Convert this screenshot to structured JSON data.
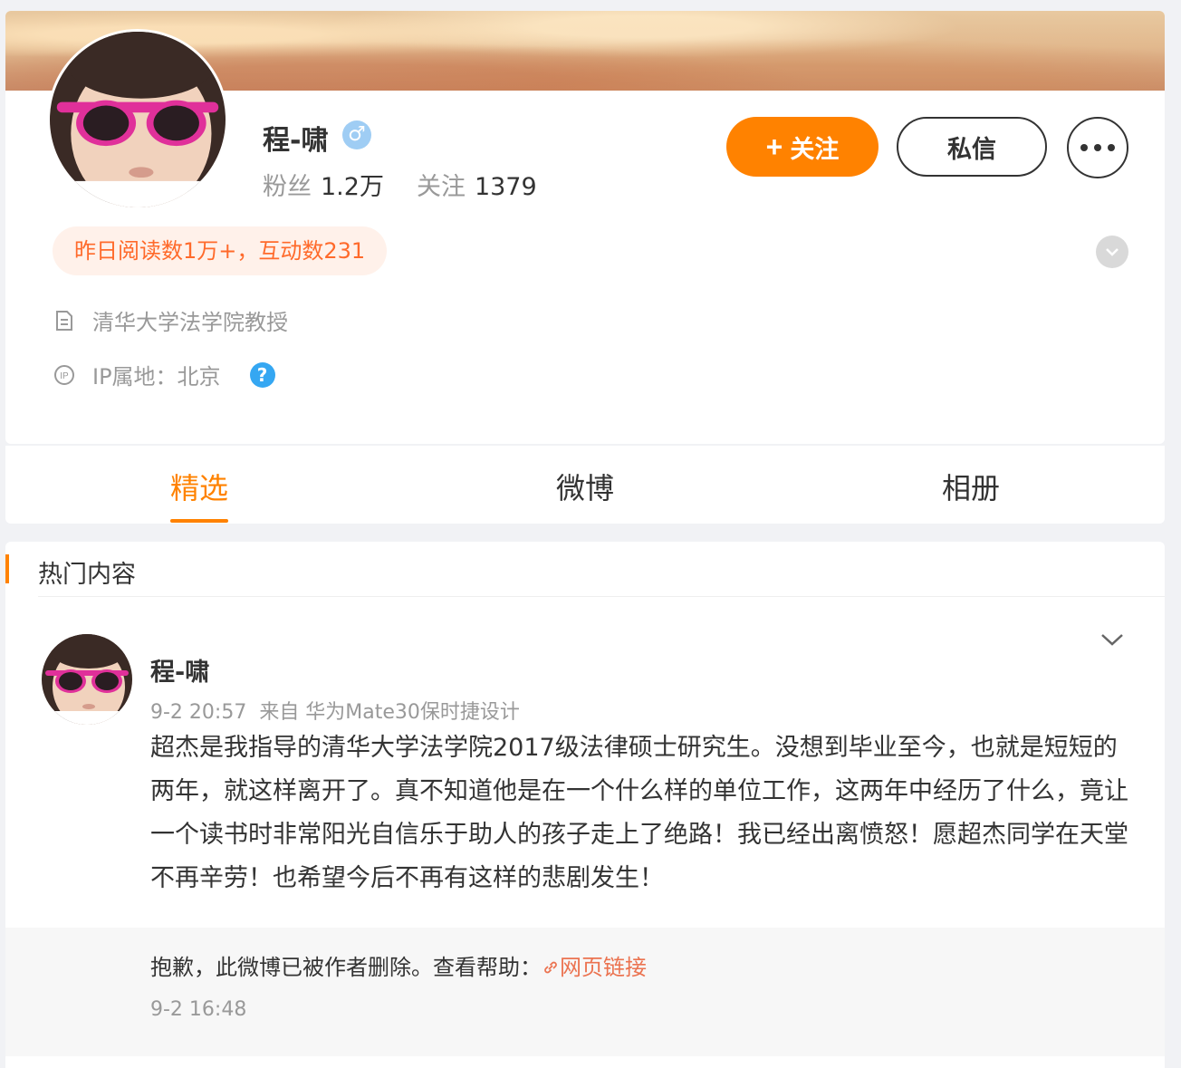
{
  "profile": {
    "name": "程-啸",
    "gender_icon": "male-icon",
    "fans_label": "粉丝",
    "fans_count": "1.2万",
    "follow_label": "关注",
    "follow_count": "1379",
    "follow_button": "关注",
    "message_button": "私信",
    "reads_badge": "昨日阅读数1万+，互动数231",
    "bio": "清华大学法学院教授",
    "ip_location": "IP属地：北京"
  },
  "tabs": [
    {
      "label": "精选",
      "active": true
    },
    {
      "label": "微博",
      "active": false
    },
    {
      "label": "相册",
      "active": false
    }
  ],
  "hot": {
    "title": "热门内容",
    "post": {
      "author": "程-啸",
      "meta": "9-2 20:57  来自 华为Mate30保时捷设计",
      "text": "超杰是我指导的清华大学法学院2017级法律硕士研究生。没想到毕业至今，也就是短短的两年，就这样离开了。真不知道他是在一个什么样的单位工作，这两年中经历了什么，竟让一个读书时非常阳光自信乐于助人的孩子走上了绝路！我已经出离愤怒！愿超杰同学在天堂不再辛劳！也希望今后不再有这样的悲剧发生！"
    },
    "repost": {
      "text": "抱歉，此微博已被作者删除。查看帮助：",
      "link_label": "网页链接",
      "time": "9-2 16:48"
    }
  },
  "colors": {
    "accent": "#ff8200",
    "link": "#eb7350",
    "badge_bg": "#fff1ea",
    "badge_text": "#ff6a2b"
  }
}
